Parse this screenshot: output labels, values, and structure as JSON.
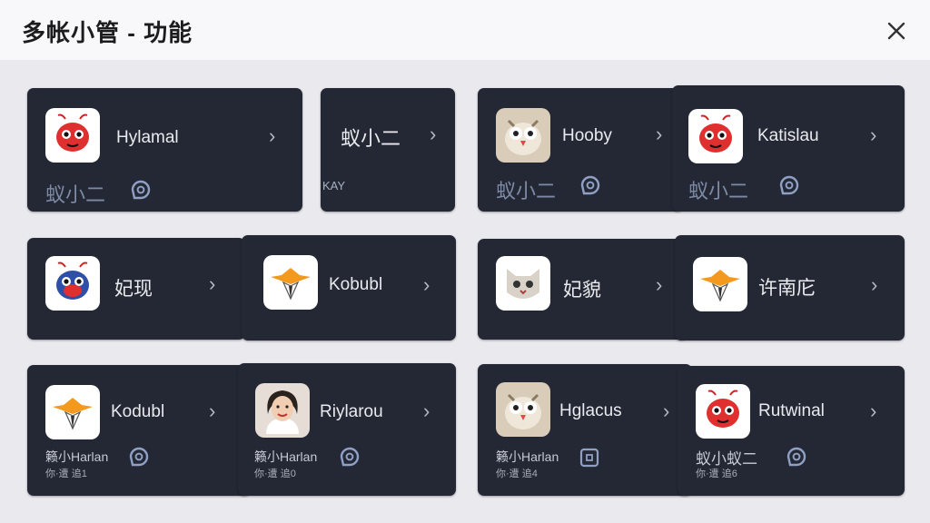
{
  "header": {
    "title": "多帐小管 - 功能"
  },
  "cards": [
    {
      "name": "Hylamal",
      "sub": "蚁小二"
    },
    {
      "name": "蚁小二",
      "tag": "KAY"
    },
    {
      "name": "Hooby",
      "sub": "蚁小二"
    },
    {
      "name": "Katislau",
      "sub": "蚁小二"
    },
    {
      "name": "妃现"
    },
    {
      "name": "Kobubl"
    },
    {
      "name": "妃貌"
    },
    {
      "name": "许南庀"
    },
    {
      "name": "Kodubl",
      "sub": "籁小Harlan",
      "sub2": "你·遭 追1"
    },
    {
      "name": "Riylarou",
      "sub": "籁小Harlan",
      "sub2": "你·遭 追0"
    },
    {
      "name": "Hglacus",
      "sub": "籁小Harlan",
      "sub2": "你·遭 追4"
    },
    {
      "name": "Rutwinal",
      "sub": "蚁小蚁二",
      "sub2": "你·遭 追6"
    }
  ],
  "icons": {
    "close": "close-icon",
    "chevron": "chevron-right-icon",
    "badge": "link-badge-icon",
    "apps": [
      "red-ant-icon",
      "owl-icon",
      "blue-ant-icon",
      "fox-icon",
      "cat-icon",
      "person-avatar"
    ]
  },
  "chevron": "›",
  "colors": {
    "card": "#242834",
    "sub": "#7d8aa6",
    "ant_red": "#e02f2f"
  }
}
